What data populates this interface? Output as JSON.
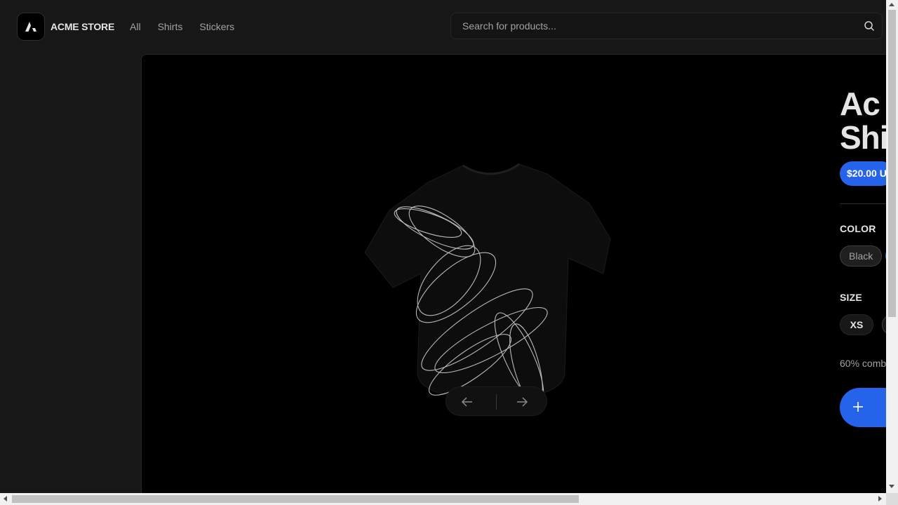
{
  "header": {
    "brand": "ACME STORE",
    "nav": [
      "All",
      "Shirts",
      "Stickers"
    ],
    "search_placeholder": "Search for products..."
  },
  "product": {
    "title": "Acme\nShirt",
    "title_visible": "Ac\nShi",
    "price_visible": "$20.00 U",
    "color_label": "COLOR",
    "color_options": [
      "Black"
    ],
    "size_label": "SIZE",
    "size_options": [
      "XS"
    ],
    "description_visible": "60% comb"
  },
  "colors": {
    "background": "#171717",
    "panel": "#000000",
    "accent": "#2563eb"
  },
  "icons": {
    "logo": "acme-logo-icon",
    "search": "search-icon",
    "prev": "arrow-left-icon",
    "next": "arrow-right-icon",
    "add": "plus-icon"
  }
}
